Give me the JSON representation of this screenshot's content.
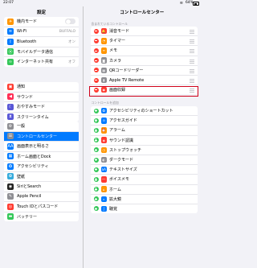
{
  "status": {
    "time": "22:07",
    "battery": "64%"
  },
  "colors": {
    "accent": "#007aff",
    "highlight": "#d0021b"
  },
  "left": {
    "title": "設定",
    "group1": [
      {
        "label": "機内モード",
        "icon": "airplane-icon",
        "color": "#ff9500",
        "glyph": "✈",
        "toggle": true
      },
      {
        "label": "Wi-Fi",
        "icon": "wifi-icon",
        "color": "#007aff",
        "glyph": "≋",
        "value": "BUFFALO"
      },
      {
        "label": "Bluetooth",
        "icon": "bluetooth-icon",
        "color": "#007aff",
        "glyph": "ᛒ",
        "value": "オン"
      },
      {
        "label": "モバイルデータ通信",
        "icon": "antenna-icon",
        "color": "#34c759",
        "glyph": "⦿"
      },
      {
        "label": "インターネット共有",
        "icon": "hotspot-icon",
        "color": "#34c759",
        "glyph": "∞",
        "value": "オフ"
      }
    ],
    "group2": [
      {
        "label": "通知",
        "icon": "notification-icon",
        "color": "#ff3b30",
        "glyph": "▣"
      },
      {
        "label": "サウンド",
        "icon": "speaker-icon",
        "color": "#ff2d55",
        "glyph": "◀"
      },
      {
        "label": "おやすみモード",
        "icon": "moon-icon",
        "color": "#5856d6",
        "glyph": "☾"
      },
      {
        "label": "スクリーンタイム",
        "icon": "hourglass-icon",
        "color": "#5856d6",
        "glyph": "⧗"
      }
    ],
    "group3": [
      {
        "label": "一般",
        "icon": "gear-icon",
        "color": "#8e8e93",
        "glyph": "⚙"
      },
      {
        "label": "コントロールセンター",
        "icon": "control-center-icon",
        "color": "#8e8e93",
        "glyph": "☰",
        "selected": true
      },
      {
        "label": "画面表示と明るさ",
        "icon": "brightness-icon",
        "color": "#007aff",
        "glyph": "AA"
      },
      {
        "label": "ホーム画面とDock",
        "icon": "home-screen-icon",
        "color": "#007aff",
        "glyph": "▦"
      },
      {
        "label": "アクセシビリティ",
        "icon": "accessibility-icon",
        "color": "#007aff",
        "glyph": "✪"
      },
      {
        "label": "壁紙",
        "icon": "wallpaper-icon",
        "color": "#34aadc",
        "glyph": "✿"
      },
      {
        "label": "SiriとSearch",
        "icon": "siri-icon",
        "color": "#222222",
        "glyph": "◉"
      },
      {
        "label": "Apple Pencil",
        "icon": "pencil-icon",
        "color": "#8e8e93",
        "glyph": "✎"
      },
      {
        "label": "Touch IDとパスコード",
        "icon": "fingerprint-icon",
        "color": "#ff3b30",
        "glyph": "◎"
      },
      {
        "label": "バッテリー",
        "icon": "battery-icon",
        "color": "#34c759",
        "glyph": "▬"
      }
    ]
  },
  "right": {
    "title": "コントロールセンター",
    "included_header": "含まれているコントロール",
    "more_header": "コントロールを追加",
    "included": [
      {
        "label": "消音モード",
        "icon": "bell-icon",
        "color": "#ff3b30",
        "glyph": "🔔"
      },
      {
        "label": "タイマー",
        "icon": "timer-icon",
        "color": "#ff9500",
        "glyph": "◔"
      },
      {
        "label": "メモ",
        "icon": "notes-icon",
        "color": "#ff9500",
        "glyph": "≡"
      },
      {
        "label": "カメラ",
        "icon": "camera-icon",
        "color": "#8e8e93",
        "glyph": "◙"
      },
      {
        "label": "QRコードリーダー",
        "icon": "qr-code-icon",
        "color": "#8e8e93",
        "glyph": "▦"
      },
      {
        "label": "Apple TV Remote",
        "icon": "remote-icon",
        "color": "#8e8e93",
        "glyph": "▮"
      },
      {
        "label": "画面収録",
        "icon": "record-icon",
        "color": "#ff3b30",
        "glyph": "◉",
        "highlighted": true
      }
    ],
    "more": [
      {
        "label": "アクセシビリティのショートカット",
        "icon": "accessibility-icon",
        "color": "#007aff",
        "glyph": "✪"
      },
      {
        "label": "アクセスガイド",
        "icon": "lock-icon",
        "color": "#007aff",
        "glyph": "⊙"
      },
      {
        "label": "アラーム",
        "icon": "alarm-icon",
        "color": "#ff9500",
        "glyph": "⏰"
      },
      {
        "label": "サウンド認識",
        "icon": "sound-recognition-icon",
        "color": "#ff3b30",
        "glyph": "◈"
      },
      {
        "label": "ストップウォッチ",
        "icon": "stopwatch-icon",
        "color": "#ff9500",
        "glyph": "◷"
      },
      {
        "label": "ダークモード",
        "icon": "dark-mode-icon",
        "color": "#8e8e93",
        "glyph": "◐"
      },
      {
        "label": "テキストサイズ",
        "icon": "text-size-icon",
        "color": "#007aff",
        "glyph": "aA"
      },
      {
        "label": "ボイスメモ",
        "icon": "voice-memo-icon",
        "color": "#ff3b30",
        "glyph": "〰"
      },
      {
        "label": "ホーム",
        "icon": "home-icon",
        "color": "#ff9500",
        "glyph": "⌂"
      },
      {
        "label": "拡大鏡",
        "icon": "magnifier-icon",
        "color": "#007aff",
        "glyph": "⌕"
      },
      {
        "label": "聴覚",
        "icon": "ear-icon",
        "color": "#007aff",
        "glyph": "ʃ"
      }
    ]
  }
}
